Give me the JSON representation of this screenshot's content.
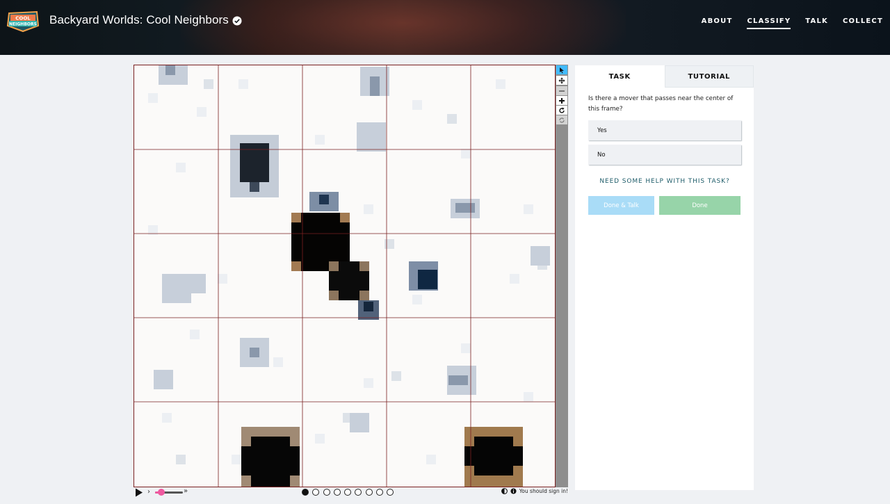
{
  "header": {
    "project_title": "Backyard Worlds: Cool Neighbors",
    "logo_text_line1": "COOL",
    "logo_text_line2": "NEIGHBORS",
    "nav": [
      {
        "label": "ABOUT",
        "active": false
      },
      {
        "label": "CLASSIFY",
        "active": true
      },
      {
        "label": "TALK",
        "active": false
      },
      {
        "label": "COLLECT",
        "active": false
      }
    ]
  },
  "toolbar": {
    "tools": [
      {
        "icon": "pointer-icon",
        "active": true
      },
      {
        "icon": "move-icon",
        "active": false
      },
      {
        "icon": "zoom-out-icon",
        "disabled": true
      },
      {
        "icon": "zoom-in-icon",
        "active": false
      },
      {
        "icon": "rotate-icon",
        "active": false
      },
      {
        "icon": "reset-icon",
        "disabled": true
      }
    ]
  },
  "player": {
    "frame_count": 9,
    "current_frame": 1,
    "signin_text": "You should sign in!"
  },
  "task": {
    "tabs": [
      {
        "label": "TASK",
        "active": true
      },
      {
        "label": "TUTORIAL",
        "active": false
      }
    ],
    "question": "Is there a mover that passes near the center of this frame?",
    "answers": [
      "Yes",
      "No"
    ],
    "help_link": "NEED SOME HELP WITH THIS TASK?",
    "done_talk_label": "Done & Talk",
    "done_label": "Done"
  },
  "colors": {
    "accent_blue": "#43bbfd",
    "done_green": "#97d4a9",
    "done_talk_blue": "#a9dcf7",
    "grid_line": "#7a2020",
    "speed_pink": "#ef5aa0"
  }
}
